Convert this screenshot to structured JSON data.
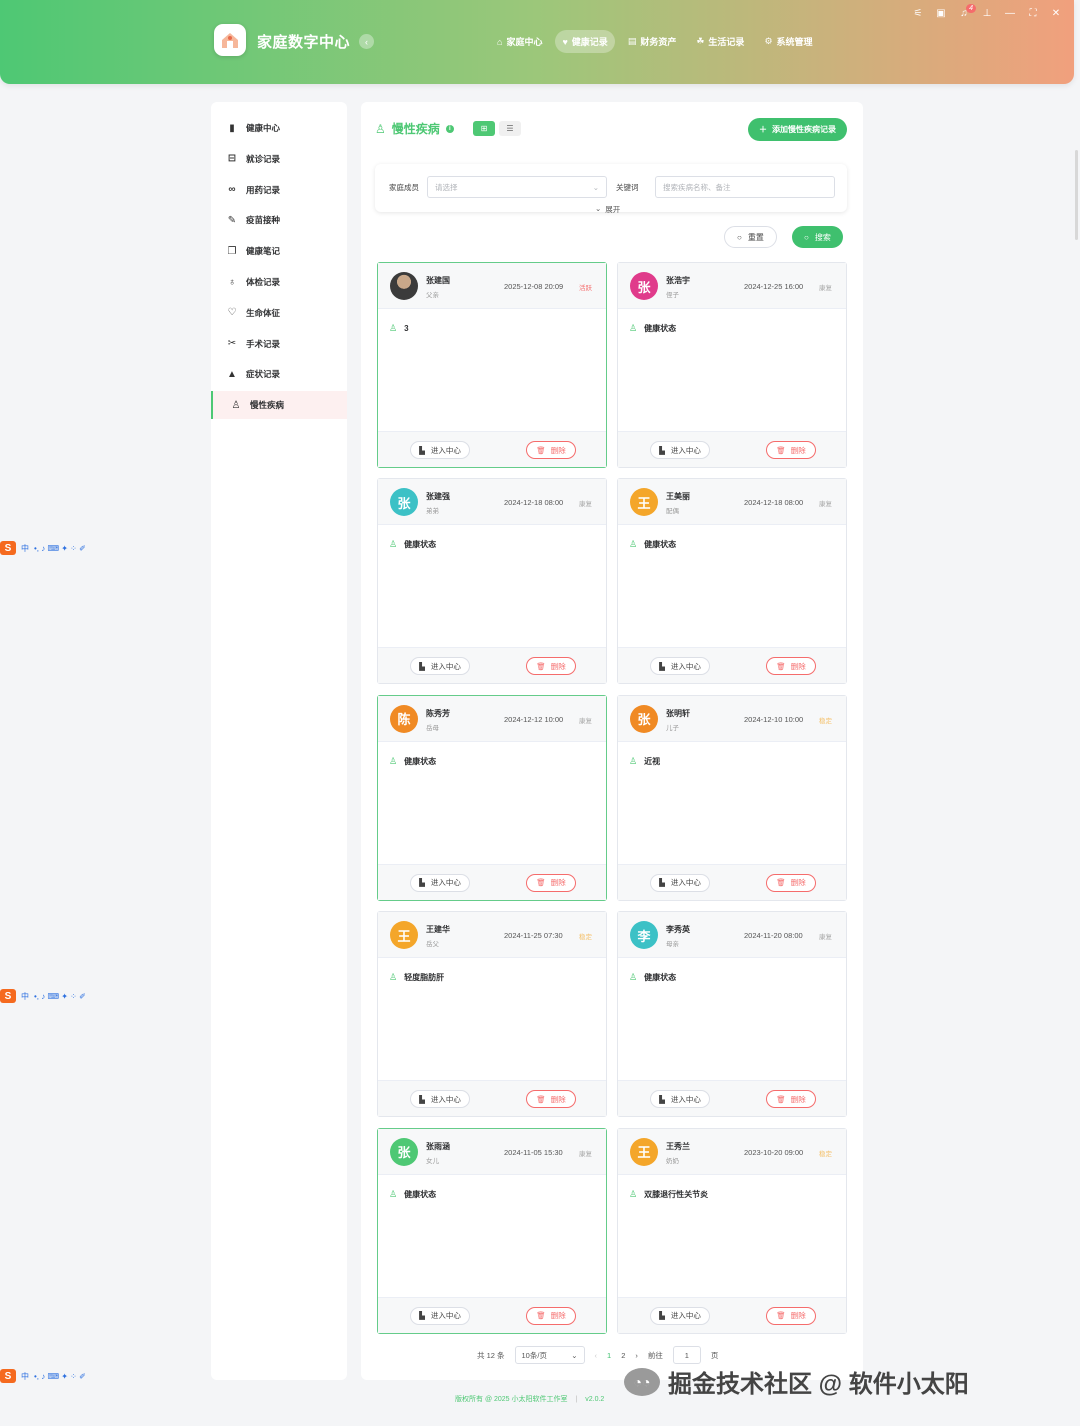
{
  "app": {
    "title": "家庭数字中心",
    "collapse_icon": "chevron-left-icon"
  },
  "topnav": [
    {
      "icon": "⌂",
      "label": "家庭中心"
    },
    {
      "icon": "♥",
      "label": "健康记录",
      "active": true
    },
    {
      "icon": "▤",
      "label": "财务资产"
    },
    {
      "icon": "☘",
      "label": "生活记录"
    },
    {
      "icon": "⚙",
      "label": "系统管理"
    }
  ],
  "window_tools": {
    "notification_count": "4"
  },
  "sidebar": [
    {
      "icon": "▮",
      "label": "健康中心"
    },
    {
      "icon": "⊟",
      "label": "就诊记录"
    },
    {
      "icon": "∞",
      "label": "用药记录"
    },
    {
      "icon": "✎",
      "label": "疫苗接种"
    },
    {
      "icon": "❐",
      "label": "健康笔记"
    },
    {
      "icon": "♁",
      "label": "体检记录"
    },
    {
      "icon": "♡",
      "label": "生命体征"
    },
    {
      "icon": "✂",
      "label": "手术记录"
    },
    {
      "icon": "▲",
      "label": "症状记录"
    },
    {
      "icon": "♙",
      "label": "慢性疾病",
      "active": true
    }
  ],
  "page": {
    "title": "慢性疾病",
    "add_button": "添加慢性疾病记录",
    "filter": {
      "member_label": "家庭成员",
      "member_placeholder": "请选择",
      "keyword_label": "关键词",
      "keyword_placeholder": "搜索疾病名称、备注",
      "expand_label": "展开"
    },
    "reset_button": "重置",
    "search_button": "搜索"
  },
  "card_actions": {
    "enter": "进入中心",
    "delete": "删除"
  },
  "records": [
    {
      "name": "张建国",
      "relation": "父亲",
      "date": "2025-12-08 20:09",
      "status": "活跃",
      "status_color": "#f56c6c",
      "avatar": "",
      "avatar_color": "#444444",
      "content": "3",
      "selected": true
    },
    {
      "name": "张浩宇",
      "relation": "侄子",
      "date": "2024-12-25 16:00",
      "status": "康复",
      "status_color": "#aaaaaa",
      "avatar": "张",
      "avatar_color": "#e03b8b",
      "content": "健康状态",
      "selected": false
    },
    {
      "name": "张建强",
      "relation": "弟弟",
      "date": "2024-12-18 08:00",
      "status": "康复",
      "status_color": "#aaaaaa",
      "avatar": "张",
      "avatar_color": "#3cc1c6",
      "content": "健康状态",
      "selected": false
    },
    {
      "name": "王美丽",
      "relation": "配偶",
      "date": "2024-12-18 08:00",
      "status": "康复",
      "status_color": "#aaaaaa",
      "avatar": "王",
      "avatar_color": "#f4a62a",
      "content": "健康状态",
      "selected": false
    },
    {
      "name": "陈秀芳",
      "relation": "岳母",
      "date": "2024-12-12 10:00",
      "status": "康复",
      "status_color": "#aaaaaa",
      "avatar": "陈",
      "avatar_color": "#f08a24",
      "content": "健康状态",
      "selected": true
    },
    {
      "name": "张明轩",
      "relation": "儿子",
      "date": "2024-12-10 10:00",
      "status": "稳定",
      "status_color": "#f4c06a",
      "avatar": "张",
      "avatar_color": "#f08a24",
      "content": "近视",
      "selected": false
    },
    {
      "name": "王建华",
      "relation": "岳父",
      "date": "2024-11-25 07:30",
      "status": "稳定",
      "status_color": "#f4c06a",
      "avatar": "王",
      "avatar_color": "#f4a62a",
      "content": "轻度脂肪肝",
      "selected": false
    },
    {
      "name": "李秀英",
      "relation": "母亲",
      "date": "2024-11-20 08:00",
      "status": "康复",
      "status_color": "#aaaaaa",
      "avatar": "李",
      "avatar_color": "#3cc1c6",
      "content": "健康状态",
      "selected": false
    },
    {
      "name": "张雨涵",
      "relation": "女儿",
      "date": "2024-11-05 15:30",
      "status": "康复",
      "status_color": "#aaaaaa",
      "avatar": "张",
      "avatar_color": "#4ec874",
      "content": "健康状态",
      "selected": true
    },
    {
      "name": "王秀兰",
      "relation": "奶奶",
      "date": "2023-10-20 09:00",
      "status": "稳定",
      "status_color": "#f4c06a",
      "avatar": "王",
      "avatar_color": "#f4a62a",
      "content": "双膝退行性关节炎",
      "selected": false
    }
  ],
  "pagination": {
    "total": "共 12 条",
    "page_size": "10条/页",
    "pages": [
      "1",
      "2"
    ],
    "current": "1",
    "goto_label": "前往",
    "goto_value": "1",
    "goto_unit": "页"
  },
  "footer": {
    "copyright": "版权所有 @ 2025 小太阳软件工作室",
    "version": "v2.0.2"
  },
  "watermark": "掘金技术社区 @ 软件小太阳",
  "ime_toolbar": {
    "lang": "中",
    "glyphs": "•, ♪ ⌨ ✦ ⁘ ✐"
  }
}
